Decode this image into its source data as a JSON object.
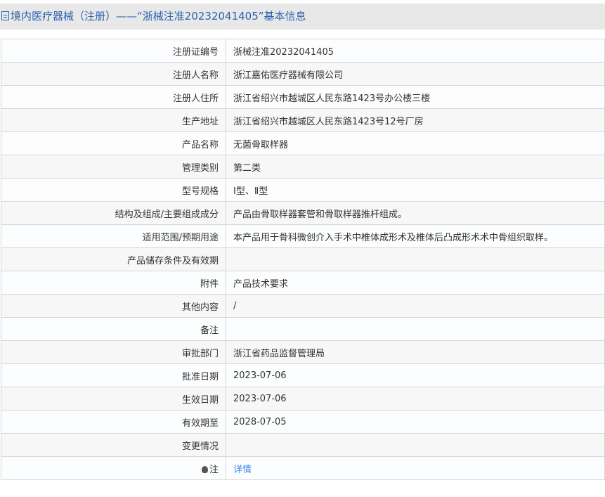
{
  "header": {
    "title": "境内医疗器械（注册）——“浙械注准20232041405”基本信息"
  },
  "rows": [
    {
      "label": "注册证编号",
      "value": "浙械注准20232041405"
    },
    {
      "label": "注册人名称",
      "value": "浙江嘉佑医疗器械有限公司"
    },
    {
      "label": "注册人住所",
      "value": "浙江省绍兴市越城区人民东路1423号办公楼三楼"
    },
    {
      "label": "生产地址",
      "value": "浙江省绍兴市越城区人民东路1423号12号厂房"
    },
    {
      "label": "产品名称",
      "value": "无菌骨取样器"
    },
    {
      "label": "管理类别",
      "value": "第二类"
    },
    {
      "label": "型号规格",
      "value": "Ⅰ型、Ⅱ型"
    },
    {
      "label": "结构及组成/主要组成成分",
      "value": "产品由骨取样器套管和骨取样器推杆组成。"
    },
    {
      "label": "适用范围/预期用途",
      "value": "本产品用于骨科微创介入手术中椎体成形术及椎体后凸成形术术中骨组织取样。"
    },
    {
      "label": "产品储存条件及有效期",
      "value": ""
    },
    {
      "label": "附件",
      "value": "产品技术要求"
    },
    {
      "label": "其他内容",
      "value": "/"
    },
    {
      "label": "备注",
      "value": ""
    },
    {
      "label": "审批部门",
      "value": "浙江省药品监督管理局"
    },
    {
      "label": "批准日期",
      "value": "2023-07-06"
    },
    {
      "label": "生效日期",
      "value": "2023-07-06"
    },
    {
      "label": "有效期至",
      "value": "2028-07-05"
    },
    {
      "label": "变更情况",
      "value": ""
    }
  ],
  "note": {
    "label": "注",
    "link": "详情"
  }
}
